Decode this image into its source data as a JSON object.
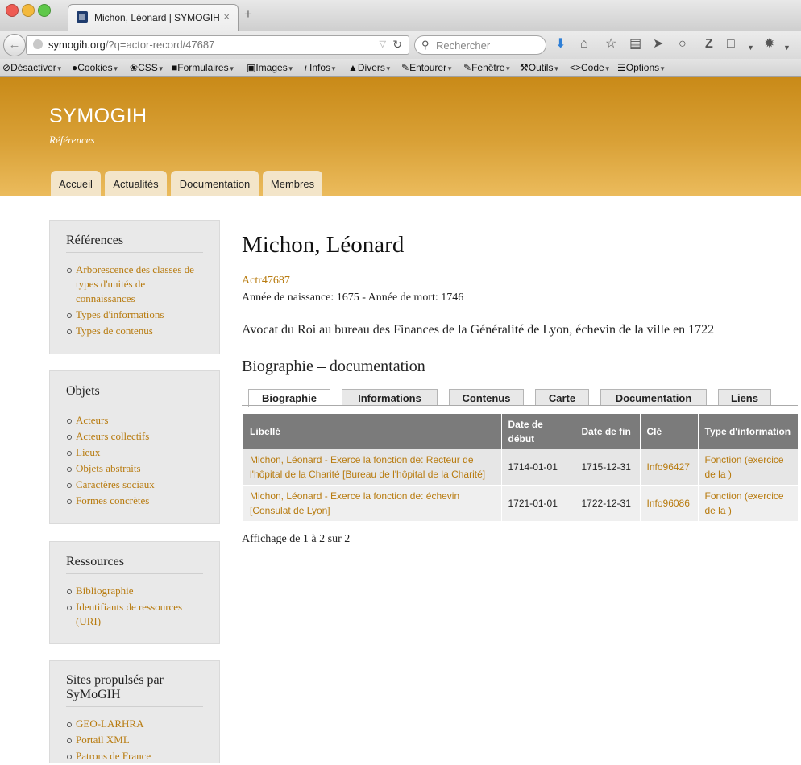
{
  "browser": {
    "tab_title": "Michon, Léonard | SYMOGIH",
    "tab_close": "×",
    "new_tab": "+",
    "url_host": "symogih.org",
    "url_rest": "/?q=actor-record/47687",
    "search_placeholder": "Rechercher"
  },
  "devtoolbar": {
    "items": [
      "Désactiver",
      "Cookies",
      "CSS",
      "Formulaires",
      "Images",
      "Infos",
      "Divers",
      "Entourer",
      "Fenêtre",
      "Outils",
      "Code",
      "Options"
    ]
  },
  "site": {
    "name": "SYMOGIH",
    "slogan": "Références",
    "primary_tabs": [
      "Accueil",
      "Actualités",
      "Documentation",
      "Membres"
    ]
  },
  "sidebar": {
    "blocks": [
      {
        "title": "Références",
        "items": [
          "Arborescence des classes de types d'unités de connaissances",
          "Types d'informations",
          "Types de contenus"
        ]
      },
      {
        "title": "Objets",
        "items": [
          "Acteurs",
          "Acteurs collectifs",
          "Lieux",
          "Objets abstraits",
          "Caractères sociaux",
          "Formes concrètes"
        ]
      },
      {
        "title": "Ressources",
        "items": [
          "Bibliographie",
          "Identifiants de ressources (URI)"
        ]
      },
      {
        "title": "Sites propulsés par SyMoGIH",
        "items": [
          "GEO-LARHRA",
          "Portail XML",
          "Patrons de France"
        ]
      }
    ]
  },
  "main": {
    "title": "Michon, Léonard",
    "actor_id": "Actr47687",
    "lifespan": "Année de naissance: 1675 - Année de mort: 1746",
    "description": "Avocat du Roi au bureau des Finances de la Généralité de Lyon, échevin de la ville en 1722",
    "section_title": "Biographie – documentation",
    "tabs": [
      "Biographie",
      "Informations",
      "Contenus",
      "Carte",
      "Documentation",
      "Liens"
    ],
    "active_tab": "Biographie",
    "table": {
      "headers": [
        "Libellé",
        "Date de début",
        "Date de fin",
        "Clé",
        "Type d'information"
      ],
      "rows": [
        {
          "label": "Michon, Léonard - Exerce la fonction de: Recteur de l'hôpital de la Charité [Bureau de l'hôpital de la Charité]",
          "start": "1714-01-01",
          "end": "1715-12-31",
          "key": "Info96427",
          "type": "Fonction (exercice de la )"
        },
        {
          "label": "Michon, Léonard - Exerce la fonction de: échevin [Consulat de Lyon]",
          "start": "1721-01-01",
          "end": "1722-12-31",
          "key": "Info96086",
          "type": "Fonction (exercice de la )"
        }
      ]
    },
    "pager": "Affichage de 1 à 2 sur 2"
  },
  "colors": {
    "accent_link": "#b87b0f",
    "header_top": "#c98a18",
    "header_bottom": "#ebbb5c",
    "table_header": "#7b7b7b"
  }
}
